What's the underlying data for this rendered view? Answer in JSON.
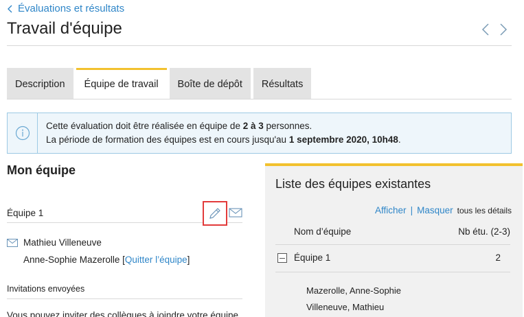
{
  "breadcrumb": {
    "label": "Évaluations et résultats"
  },
  "page": {
    "title": "Travail d'équipe"
  },
  "tabs": [
    {
      "label": "Description",
      "active": false
    },
    {
      "label": "Équipe de travail",
      "active": true
    },
    {
      "label": "Boîte de dépôt",
      "active": false
    },
    {
      "label": "Résultats",
      "active": false
    }
  ],
  "info": {
    "line1_pre": "Cette évaluation doit être réalisée en équipe de ",
    "line1_bold": "2 à 3",
    "line1_post": " personnes.",
    "line2_pre": "La période de formation des équipes est en cours jusqu'au ",
    "line2_bold": "1 septembre 2020, 10h48",
    "line2_post": "."
  },
  "my_team": {
    "section_title": "Mon équipe",
    "team_name": "Équipe 1",
    "members": [
      {
        "name": "Mathieu Villeneuve"
      },
      {
        "name": "Anne-Sophie Mazerolle",
        "leave_open": " [",
        "leave_link": "Quitter l’équipe",
        "leave_close": "]"
      }
    ],
    "invitations_label": "Invitations envoyées",
    "invite_text": "Vous pouvez inviter des collègues à joindre votre équipe."
  },
  "teams_panel": {
    "title": "Liste des équipes existantes",
    "show_label": "Afficher",
    "separator": "|",
    "hide_label": "Masquer",
    "details_label": "tous les détails",
    "col_name": "Nom d’équipe",
    "col_count": "Nb étu. (2-3)",
    "teams": [
      {
        "name": "Équipe 1",
        "count": "2",
        "members": [
          "Mazerolle, Anne-Sophie",
          "Villeneuve, Mathieu"
        ]
      }
    ]
  },
  "colors": {
    "accent": "#f2c12e",
    "link": "#2f86c8",
    "info_border": "#9cc9e4",
    "highlight": "#e23a3a"
  }
}
